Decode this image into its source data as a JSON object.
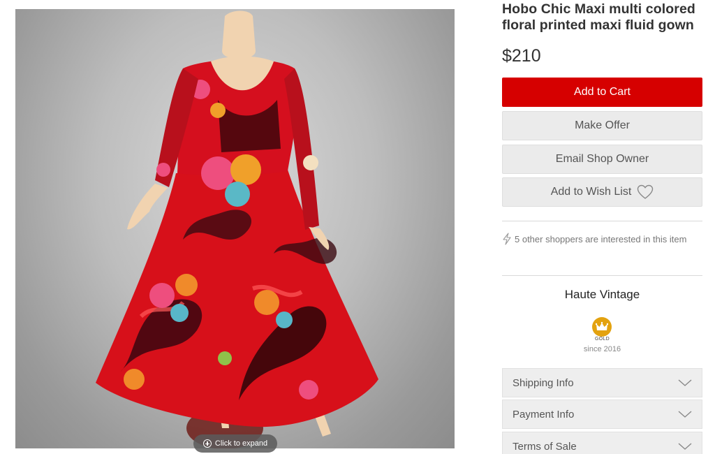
{
  "image": {
    "alt": "Floral printed maxi gown on mannequin",
    "expand_label": "Click to expand"
  },
  "product": {
    "title": "Hobo Chic Maxi multi colored floral printed maxi fluid gown",
    "price": "$210"
  },
  "actions": {
    "add_to_cart": "Add to Cart",
    "make_offer": "Make Offer",
    "email_owner": "Email Shop Owner",
    "wish_list": "Add to Wish List"
  },
  "interest": {
    "text": "5 other shoppers are interested in this item"
  },
  "shop": {
    "name": "Haute Vintage",
    "tier": "GOLD",
    "since": "since 2016"
  },
  "accordion": {
    "shipping": "Shipping Info",
    "payment": "Payment Info",
    "terms": "Terms of Sale"
  },
  "colors": {
    "primary_button": "#d60000",
    "secondary_button": "#ebebeb",
    "gold_badge": "#e3a20f"
  },
  "icons": {
    "expand": "plus-circle-icon",
    "wish": "heart-outline-icon",
    "interest": "lightning-icon",
    "badge": "crown-icon",
    "accordion": "chevron-down-icon"
  }
}
